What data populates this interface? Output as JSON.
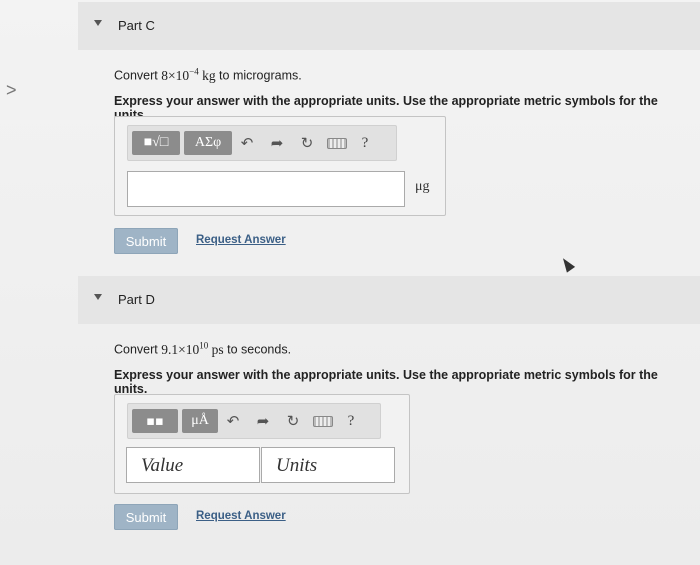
{
  "partC": {
    "title": "Part C",
    "question_prefix": "Convert ",
    "q_base": "8×10",
    "q_exp": "−4",
    "q_unit": " kg",
    "question_suffix": " to micrograms.",
    "instruction": "Express your answer with the appropriate units. Use the appropriate metric symbols for the units.",
    "toolbar": {
      "template_label": "■√□",
      "greek_label": "ΑΣφ",
      "help_label": "?"
    },
    "unit": "μg",
    "submit_label": "Submit",
    "request_label": "Request Answer"
  },
  "partD": {
    "title": "Part D",
    "question_prefix": "Convert ",
    "q_base": "9.1×10",
    "q_exp": "10",
    "q_unit": " ps",
    "question_suffix": " to seconds.",
    "instruction": "Express your answer with the appropriate units. Use the appropriate metric symbols for the units.",
    "toolbar": {
      "units_label": "μÅ",
      "help_label": "?"
    },
    "value_placeholder": "Value",
    "units_placeholder": "Units",
    "submit_label": "Submit",
    "request_label": "Request Answer"
  },
  "icons": [
    "chevron-right-icon",
    "caret-down-icon",
    "undo-icon",
    "redo-icon",
    "reset-icon",
    "keyboard-icon",
    "cursor-icon"
  ]
}
